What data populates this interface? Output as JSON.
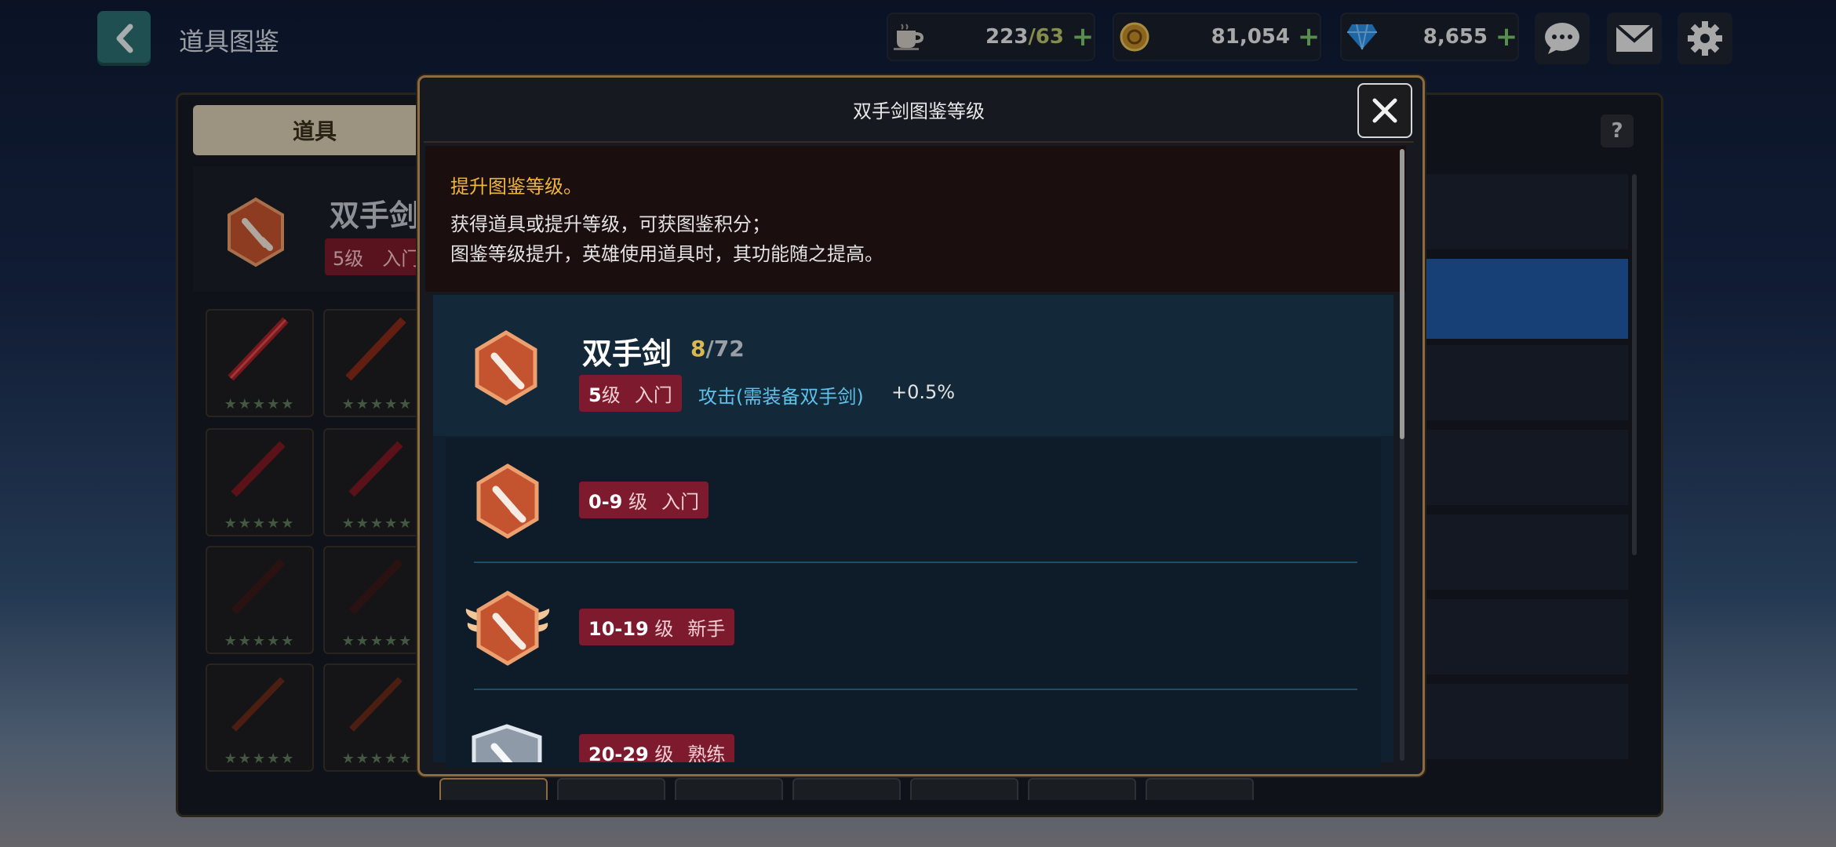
{
  "header": {
    "title": "道具图鉴",
    "resources": [
      {
        "name": "stamina",
        "icon": "coffee-cup-icon",
        "value": "223",
        "max": "/63"
      },
      {
        "name": "gold",
        "icon": "gold-coin-icon",
        "value": "81,054"
      },
      {
        "name": "gems",
        "icon": "diamond-icon",
        "value": "8,655"
      }
    ],
    "actions": [
      "chat-icon",
      "mail-icon",
      "gear-icon"
    ]
  },
  "background": {
    "tab_label": "道具",
    "item_name": "双手剑",
    "item_level": "5级　入门",
    "help": "?"
  },
  "modal": {
    "title": "双手剑图鉴等级",
    "info_head": "提升图鉴等级。",
    "info_lines": [
      "获得道具或提升等级，可获图鉴积分；",
      "图鉴等级提升，英雄使用道具时，其功能随之提高。"
    ],
    "summary": {
      "name": "双手剑",
      "count": "8",
      "total": "/72",
      "level_num": "5",
      "level_unit": "级",
      "level_rank": "入门",
      "effect": "攻击(需装备双手剑)",
      "effect_value": "+0.5%"
    },
    "tiers": [
      {
        "range": "0-9",
        "unit": "级",
        "rank": "入门",
        "badge": "bronze-hex-sword-badge"
      },
      {
        "range": "10-19",
        "unit": "级",
        "rank": "新手",
        "badge": "winged-hex-sword-badge"
      },
      {
        "range": "20-29",
        "unit": "级",
        "rank": "熟练",
        "badge": "silver-shield-sword-badge"
      }
    ]
  },
  "colors": {
    "accent_gold": "#8d6b42",
    "level_tag": "#7d1a2d",
    "effect_blue": "#5fc0ea",
    "highlight_yellow": "#f1b53c",
    "selected_blue": "#2159a4"
  }
}
